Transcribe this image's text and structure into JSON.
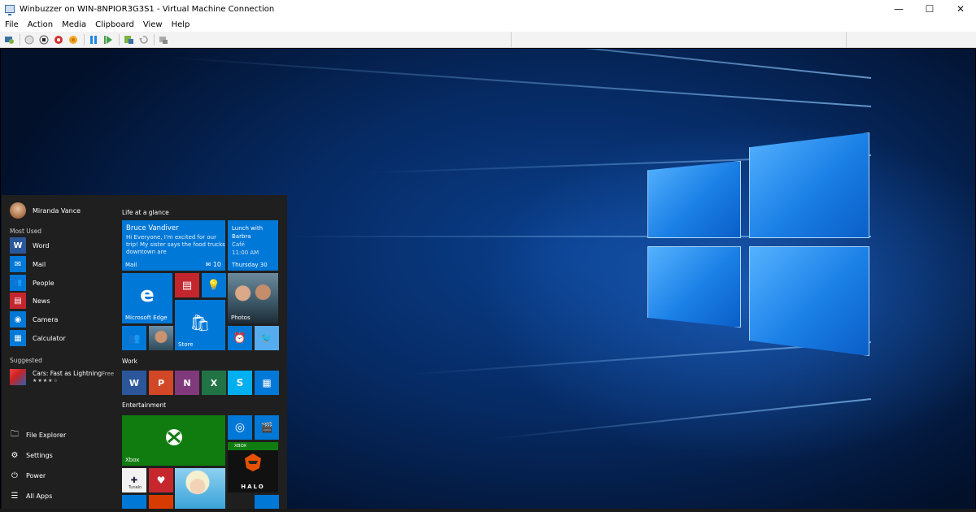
{
  "window": {
    "title": "Winbuzzer on WIN-8NPIOR3G3S1 - Virtual Machine Connection",
    "controls": {
      "minimize": "—",
      "maximize": "☐",
      "close": "✕"
    }
  },
  "menu": [
    "File",
    "Action",
    "Media",
    "Clipboard",
    "View",
    "Help"
  ],
  "toolbar_icons": [
    "ctrl-alt-del-icon",
    "start-icon",
    "turn-off-icon",
    "shutdown-icon",
    "save-icon",
    "pause-icon",
    "reset-icon",
    "checkpoint-icon",
    "revert-icon",
    "enhanced-session-icon"
  ],
  "start_menu": {
    "user": "Miranda Vance",
    "most_used_label": "Most Used",
    "most_used": [
      {
        "label": "Word",
        "color": "#2b579a",
        "glyph": "W"
      },
      {
        "label": "Mail",
        "color": "#0078d7",
        "glyph": "✉"
      },
      {
        "label": "People",
        "color": "#0078d7",
        "glyph": "👥"
      },
      {
        "label": "News",
        "color": "#c4262e",
        "glyph": "▤"
      },
      {
        "label": "Camera",
        "color": "#0078d7",
        "glyph": "◉"
      },
      {
        "label": "Calculator",
        "color": "#0078d7",
        "glyph": "▦"
      }
    ],
    "suggested_label": "Suggested",
    "suggested": {
      "title": "Cars: Fast as Lightning",
      "stars": "★★★★☆",
      "price": "Free"
    },
    "system": [
      {
        "label": "File Explorer",
        "glyph": "🗀"
      },
      {
        "label": "Settings",
        "glyph": "⚙"
      },
      {
        "label": "Power",
        "glyph": "⏻"
      },
      {
        "label": "All Apps",
        "glyph": "☰"
      }
    ],
    "groups": {
      "life": "Life at a glance",
      "work": "Work",
      "entertainment": "Entertainment"
    },
    "tiles": {
      "mail": {
        "from": "Bruce Vandiver",
        "body": "Hi Everyone, I'm excited for our trip! My sister says the food trucks downtown are",
        "label": "Mail",
        "count": "10"
      },
      "calendar": {
        "line1": "Lunch with",
        "line2": "Barbra",
        "line3": "Café",
        "line4": "11:00 AM",
        "date": "Thursday 30"
      },
      "edge": {
        "label": "Microsoft Edge",
        "glyph": "e"
      },
      "photos": {
        "label": "Photos"
      },
      "store": {
        "label": "Store",
        "glyph": "🛍"
      },
      "xbox": {
        "label": "Xbox",
        "band": "XBOX",
        "halo": "HALO"
      },
      "tunein": {
        "label": "TuneIn"
      }
    },
    "colors": {
      "accent": "#0078d7",
      "xbox_green": "#107c10"
    }
  }
}
